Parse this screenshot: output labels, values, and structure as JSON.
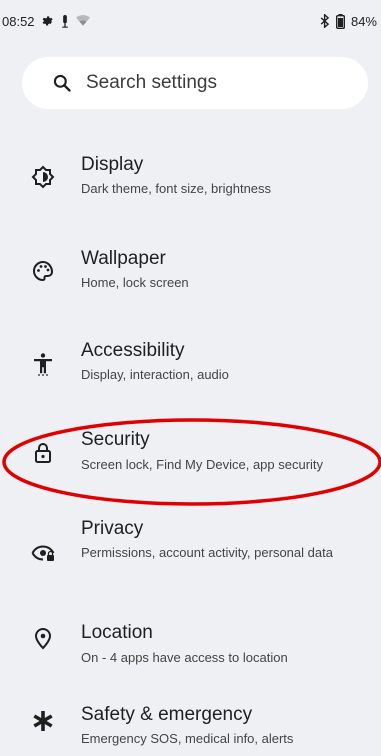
{
  "status_bar": {
    "time": "08:52",
    "battery": "84%",
    "icons": [
      "gear-icon",
      "notification-icon",
      "wifi-icon",
      "bluetooth-icon",
      "battery-icon"
    ]
  },
  "search": {
    "placeholder": "Search settings"
  },
  "settings": [
    {
      "title": "Display",
      "summary": "Dark theme, font size, brightness",
      "icon": "display-icon"
    },
    {
      "title": "Wallpaper",
      "summary": "Home, lock screen",
      "icon": "palette-icon"
    },
    {
      "title": "Accessibility",
      "summary": "Display, interaction, audio",
      "icon": "accessibility-icon"
    },
    {
      "title": "Security",
      "summary": "Screen lock, Find My Device, app security",
      "icon": "lock-icon"
    },
    {
      "title": "Privacy",
      "summary": "Permissions, account activity, personal data",
      "icon": "privacy-eye-icon"
    },
    {
      "title": "Location",
      "summary": "On - 4 apps have access to location",
      "icon": "location-pin-icon"
    },
    {
      "title": "Safety & emergency",
      "summary": "Emergency SOS, medical info, alerts",
      "icon": "asterisk-icon"
    }
  ],
  "colors": {
    "background": "#eef0f3",
    "highlight": "#e10000"
  }
}
